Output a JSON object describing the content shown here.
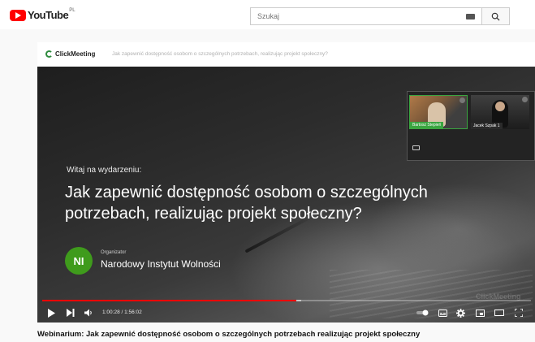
{
  "header": {
    "logo_text": "YouTube",
    "logo_sup": "PL",
    "search_placeholder": "Szukaj"
  },
  "player": {
    "brand": "ClickMeeting",
    "event_title": "Jak zapewnić dostępność osobom o szczególnych potrzebach, realizując projekt społeczny?",
    "welcome": "Witaj na wydarzeniu:",
    "main_title": "Jak zapewnić dostępność osobom o szczególnych potrzebach, realizując projekt społeczny?",
    "organizer_label": "Organizator",
    "organizer_initials": "NI",
    "organizer_name": "Narodowy Instytut Wolności",
    "cameras": [
      {
        "name": "Bartosz Stepień"
      },
      {
        "name": "Jacek Szpak 1"
      }
    ],
    "watermark": "ClickMeeting",
    "time": "1:00:28 / 1:56:02",
    "progress_fraction": 0.52,
    "buffer_fraction": 0.53
  },
  "video": {
    "title": "Webinarium: Jak zapewnić dostępność osobom o szczególnych potrzebach realizując projekt społeczny"
  },
  "colors": {
    "youtube_red": "#ff0000",
    "organizer_green": "#3f9b1c",
    "camera_active_green": "#3aa540"
  }
}
